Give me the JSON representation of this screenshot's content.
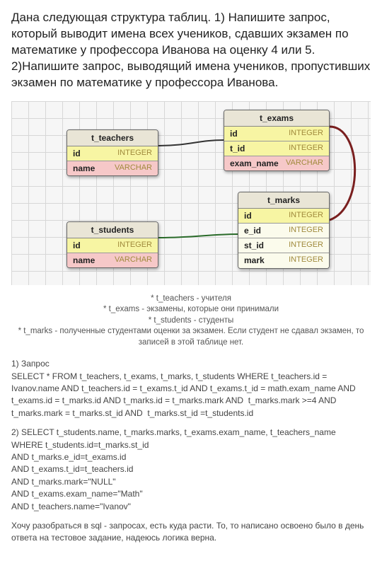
{
  "problem": "Дана следующая структура таблиц. 1) Напишите запрос, который выводит имена всех учеников, сдавших экзамен по математике у профессора Иванова на оценку 4 или 5. 2)Напишите запрос, выводящий имена учеников, пропустивших экзамен по математике у профессора Иванова.",
  "tables": {
    "teachers": {
      "title": "t_teachers",
      "cols": [
        {
          "name": "id",
          "type": "INTEGER",
          "cls": "pk"
        },
        {
          "name": "name",
          "type": "VARCHAR",
          "cls": "varchar"
        }
      ]
    },
    "exams": {
      "title": "t_exams",
      "cols": [
        {
          "name": "id",
          "type": "INTEGER",
          "cls": "pk"
        },
        {
          "name": "t_id",
          "type": "INTEGER",
          "cls": "fk"
        },
        {
          "name": "exam_name",
          "type": "VARCHAR",
          "cls": "varchar"
        }
      ]
    },
    "students": {
      "title": "t_students",
      "cols": [
        {
          "name": "id",
          "type": "INTEGER",
          "cls": "pk"
        },
        {
          "name": "name",
          "type": "VARCHAR",
          "cls": "varchar"
        }
      ]
    },
    "marks": {
      "title": "t_marks",
      "cols": [
        {
          "name": "id",
          "type": "INTEGER",
          "cls": "pk"
        },
        {
          "name": "e_id",
          "type": "INTEGER",
          "cls": "plain"
        },
        {
          "name": "st_id",
          "type": "INTEGER",
          "cls": "plain"
        },
        {
          "name": "mark",
          "type": "INTEGER",
          "cls": "plain"
        }
      ]
    }
  },
  "legend": [
    "* t_teachers - учителя",
    "* t_exams - экзамены, которые они принимали",
    "* t_students - студенты",
    "* t_marks - полученные студентами оценки за экзамен. Если студент не сдавал экзамен, то записей в этой таблице нет."
  ],
  "answers": {
    "q1": "1) Запрос\nSELECT * FROM t_teachers, t_exams, t_marks, t_students WHERE t_teachers.id = Ivanov.name AND t_teachers.id = t_exams.t_id AND t_exams.t_id = math.exam_name AND t_exams.id = t_marks.id AND t_marks.id = t_marks.mark AND  t_marks.mark >=4 AND t_marks.mark = t_marks.st_id AND  t_marks.st_id =t_students.id",
    "q2": "2) SELECT t_students.name, t_marks.marks, t_exams.exam_name, t_teachers_name\nWHERE t_students.id=t_marks.st_id\nAND t_marks.e_id=t_exams.id\nAND t_exams.t_id=t_teachers.id\nAND t_marks.mark=\"NULL\"\nAND t_exams.exam_name=\"Math\"\nAND t_teachers.name=\"Ivanov\""
  },
  "footnote": "Хочу разобраться в sql - запросах, есть куда расти. То, то написано освоено было в день ответа на тестовое задание, надеюсь логика верна."
}
